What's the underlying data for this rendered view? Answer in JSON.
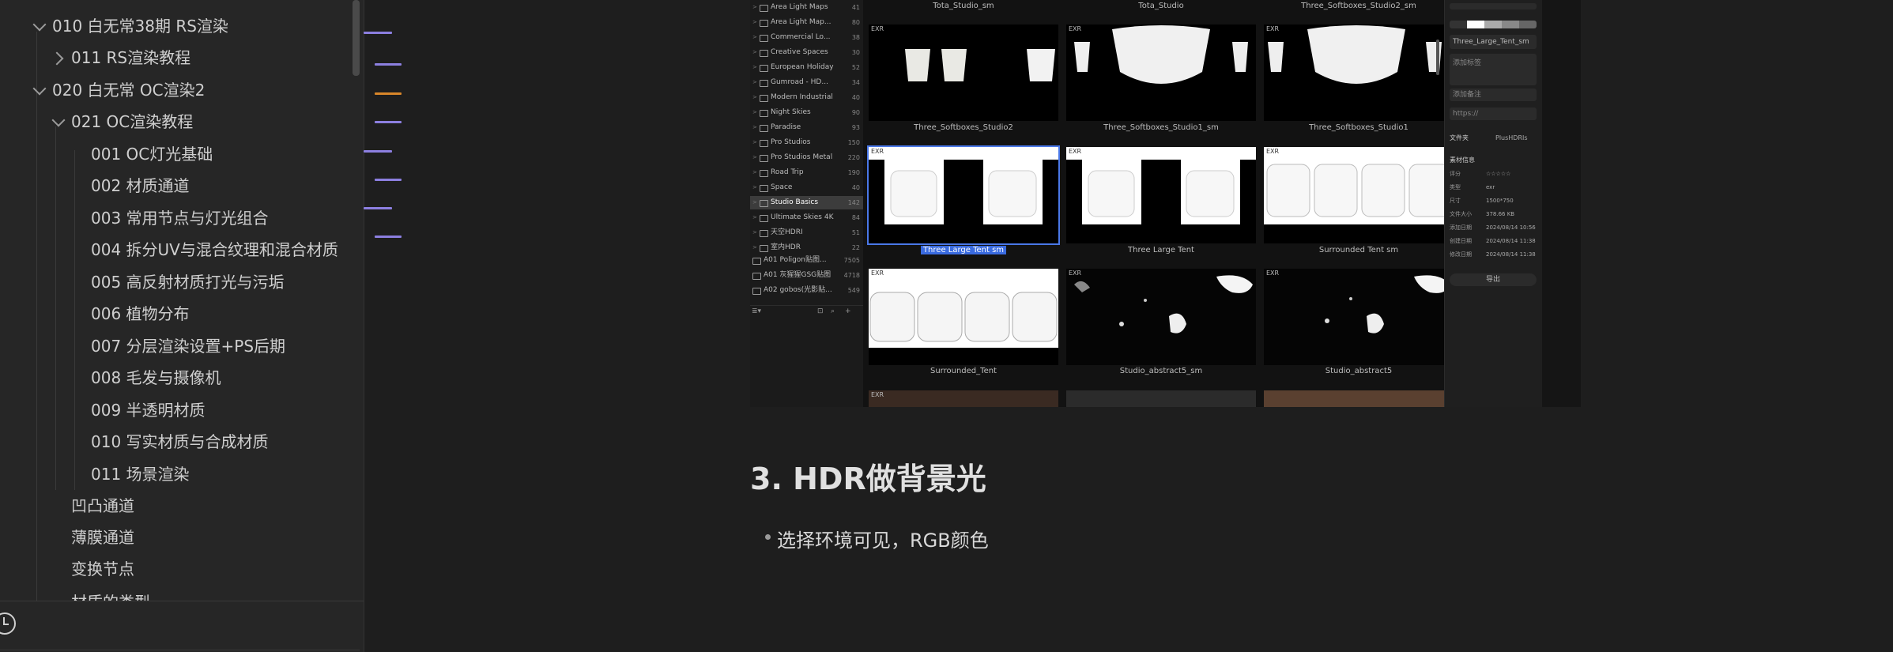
{
  "sidebar": {
    "items": [
      {
        "label": "010 白无常38期 RS渲染",
        "expanded": true
      },
      {
        "label": "011 RS渲染教程",
        "expanded": false
      },
      {
        "label": "020 白无常 OC渲染2",
        "expanded": true
      },
      {
        "label": "021 OC渲染教程",
        "expanded": true
      },
      {
        "label": "001 OC灯光基础"
      },
      {
        "label": "002 材质通道"
      },
      {
        "label": "003 常用节点与灯光组合"
      },
      {
        "label": "004 拆分UV与混合纹理和混合材质"
      },
      {
        "label": "005 高反射材质打光与污垢"
      },
      {
        "label": "006 植物分布"
      },
      {
        "label": "007 分层渲染设置+PS后期"
      },
      {
        "label": "008 毛发与摄像机"
      },
      {
        "label": "009 半透明材质"
      },
      {
        "label": "010 写实材质与合成材质"
      },
      {
        "label": "011 场景渲染"
      },
      {
        "label": "凹凸通道"
      },
      {
        "label": "薄膜通道"
      },
      {
        "label": "变换节点"
      },
      {
        "label": "材质的类型"
      }
    ],
    "history_icon": "history-icon"
  },
  "outline": {
    "colors": [
      "#8c7fe0",
      "#8c7fe0",
      "#d8862a",
      "#8c7fe0",
      "#8c7fe0",
      "#8c7fe0",
      "#8c7fe0",
      "#8c7fe0"
    ]
  },
  "screenshot": {
    "library": [
      {
        "name": "Area Light Maps",
        "count": "41"
      },
      {
        "name": "Area Light Map...",
        "count": "80"
      },
      {
        "name": "Commercial Lo...",
        "count": "38"
      },
      {
        "name": "Creative Spaces",
        "count": "30"
      },
      {
        "name": "European Holiday",
        "count": "52"
      },
      {
        "name": "Gumroad - HD...",
        "count": "34"
      },
      {
        "name": "Modern Industrial",
        "count": "40"
      },
      {
        "name": "Night Skies",
        "count": "90"
      },
      {
        "name": "Paradise",
        "count": "93"
      },
      {
        "name": "Pro Studios",
        "count": "150"
      },
      {
        "name": "Pro Studios Metal",
        "count": "220"
      },
      {
        "name": "Road Trip",
        "count": "190"
      },
      {
        "name": "Space",
        "count": "40"
      },
      {
        "name": "Studio Basics",
        "count": "142",
        "selected": true
      },
      {
        "name": "Ultimate Skies 4K",
        "count": "84"
      },
      {
        "name": "天空HDRI",
        "count": "51"
      },
      {
        "name": "室内HDR",
        "count": "22"
      },
      {
        "name": "A01 Poligon贴图...",
        "count": "7505",
        "top": true
      },
      {
        "name": "A01 灰猩猩GSG贴图",
        "count": "4718",
        "top": true
      },
      {
        "name": "A02 gobos(光影贴...",
        "count": "549",
        "top": true
      }
    ],
    "tile_badge": "EXR",
    "top_labels": [
      "Tota_Studio_sm",
      "Tota_Studio",
      "Three_Softboxes_Studio2_sm"
    ],
    "row_labels": [
      [
        "Three_Softboxes_Studio2",
        "Three_Softboxes_Studio1_sm",
        "Three_Softboxes_Studio1"
      ],
      [
        "Three Large Tent sm",
        "Three Large Tent",
        "Surrounded Tent sm"
      ],
      [
        "Surrounded_Tent",
        "Studio_abstract5_sm",
        "Studio_abstract5"
      ]
    ],
    "inspector": {
      "name_value": "Three_Large_Tent_sm",
      "tags_placeholder": "添加标签",
      "notes_placeholder": "添加备注",
      "url_placeholder": "https://",
      "folder_label": "文件夹",
      "folder_value": "PlusHDRIs",
      "info_label": "素材信息",
      "props": [
        {
          "k": "评分",
          "v": "☆☆☆☆☆"
        },
        {
          "k": "类型",
          "v": "exr"
        },
        {
          "k": "尺寸",
          "v": "1500*750"
        },
        {
          "k": "文件大小",
          "v": "378.66 KB"
        },
        {
          "k": "添加日期",
          "v": "2024/08/14 10:56"
        },
        {
          "k": "创建日期",
          "v": "2024/08/14 11:38"
        },
        {
          "k": "修改日期",
          "v": "2024/08/14 11:38"
        }
      ],
      "export_label": "导出"
    }
  },
  "document": {
    "heading": "3. HDR做背景光",
    "bullet": "选择环境可见，RGB颜色"
  }
}
